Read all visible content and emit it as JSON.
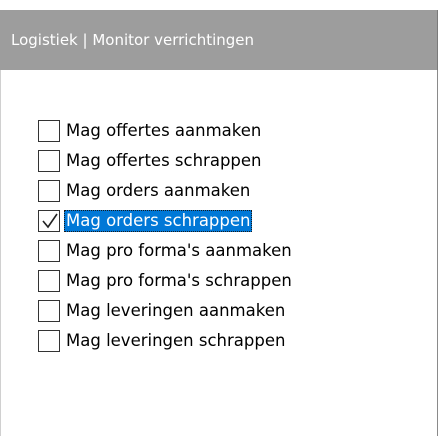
{
  "header": {
    "title": "Logistiek | Monitor verrichtingen"
  },
  "permissions": [
    {
      "label": "Mag offertes aanmaken",
      "checked": false,
      "selected": false
    },
    {
      "label": "Mag offertes schrappen",
      "checked": false,
      "selected": false
    },
    {
      "label": "Mag orders aanmaken",
      "checked": false,
      "selected": false
    },
    {
      "label": "Mag orders schrappen",
      "checked": true,
      "selected": true
    },
    {
      "label": "Mag pro forma's aanmaken",
      "checked": false,
      "selected": false
    },
    {
      "label": "Mag pro forma's schrappen",
      "checked": false,
      "selected": false
    },
    {
      "label": "Mag leveringen aanmaken",
      "checked": false,
      "selected": false
    },
    {
      "label": "Mag leveringen schrappen",
      "checked": false,
      "selected": false
    }
  ],
  "colors": {
    "header_bg": "#9d9d9d",
    "selection_bg": "#0078d7"
  }
}
